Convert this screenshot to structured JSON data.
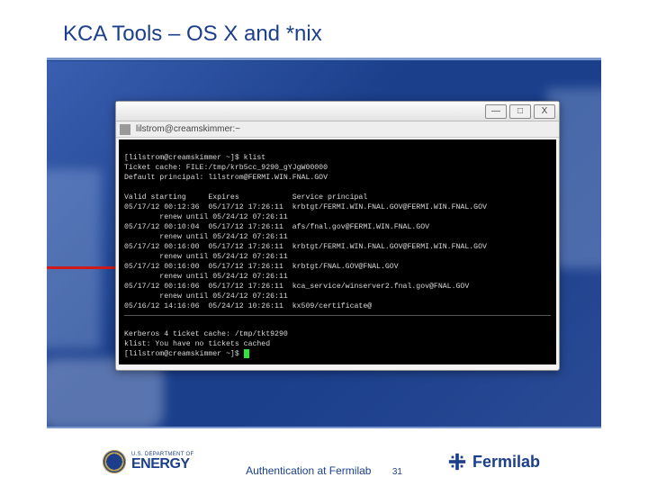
{
  "slide": {
    "title": "KCA Tools – OS X and *nix",
    "footer_text": "Authentication at Fermilab",
    "page_number": "31"
  },
  "window": {
    "buttons": {
      "min": "—",
      "max": "□",
      "close": "X"
    },
    "tab_icon": "terminal-icon",
    "tab_label": "lilstrom@creamskimmer:~"
  },
  "terminal": {
    "lines_top": [
      "[lilstrom@creamskimmer ~]$ klist",
      "Ticket cache: FILE:/tmp/krb5cc_9290_gYJgW00000",
      "Default principal: lilstrom@FERMI.WIN.FNAL.GOV",
      "",
      "Valid starting     Expires            Service principal",
      "05/17/12 00:12:36  05/17/12 17:26:11  krbtgt/FERMI.WIN.FNAL.GOV@FERMI.WIN.FNAL.GOV",
      "        renew until 05/24/12 07:26:11",
      "05/17/12 00:10:04  05/17/12 17:26:11  afs/fnal.gov@FERMI.WIN.FNAL.GOV",
      "        renew until 05/24/12 07:26:11",
      "05/17/12 00:16:00  05/17/12 17:26:11  krbtgt/FERMI.WIN.FNAL.GOV@FERMI.WIN.FNAL.GOV",
      "        renew until 05/24/12 07:26:11",
      "05/17/12 00:16:00  05/17/12 17:26:11  krbtgt/FNAL.GOV@FNAL.GOV",
      "        renew until 05/24/12 07:26:11",
      "05/17/12 00:16:06  05/17/12 17:26:11  kca_service/winserver2.fnal.gov@FNAL.GOV",
      "        renew until 05/24/12 07:26:11",
      "05/16/12 14:16:06  05/24/12 10:26:11  kx509/certificate@"
    ],
    "lines_bottom": [
      "Kerberos 4 ticket cache: /tmp/tkt9290",
      "klist: You have no tickets cached",
      "[lilstrom@creamskimmer ~]$ "
    ]
  },
  "logos": {
    "doe_small": "U.S. DEPARTMENT OF",
    "doe_big": "ENERGY",
    "fermilab": "Fermilab"
  },
  "colors": {
    "brand_blue": "#1b3f8b",
    "accent_red": "#d11a1a",
    "cursor_green": "#2ee63a"
  }
}
